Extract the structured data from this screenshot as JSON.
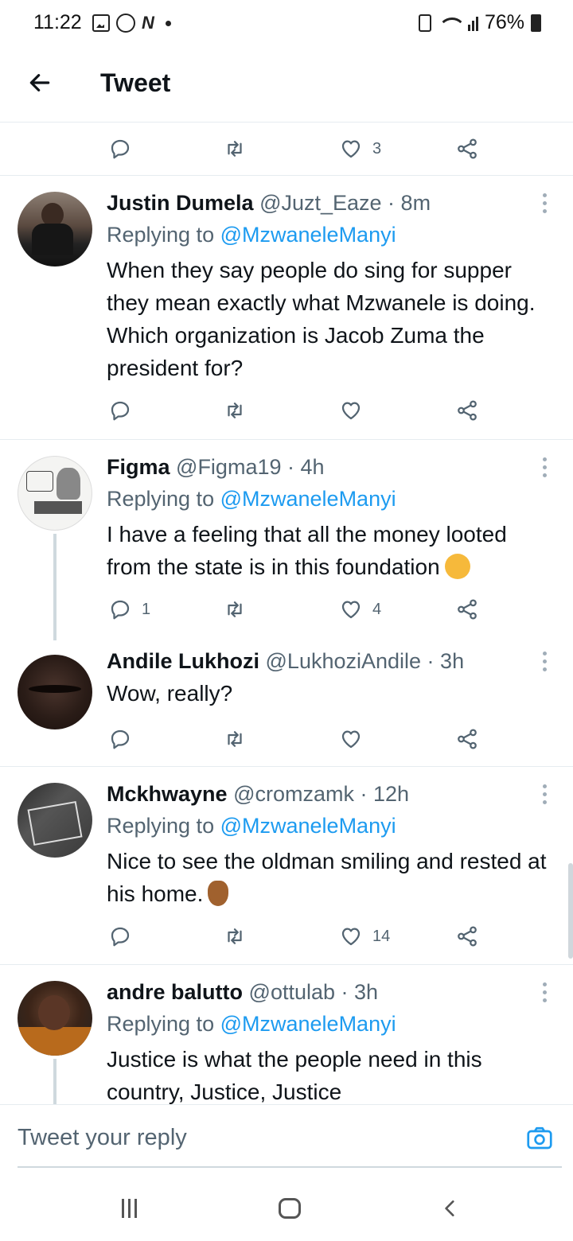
{
  "status_bar": {
    "time": "11:22",
    "battery": "76%"
  },
  "header": {
    "title": "Tweet"
  },
  "top_actions": {
    "likes": "3"
  },
  "tweets": [
    {
      "name": "Justin Dumela",
      "handle": "@Juzt_Eaze",
      "time": "8m",
      "replying_prefix": "Replying to",
      "replying_to": "@MzwaneleManyi",
      "text": "When they say people do sing for supper they mean exactly what Mzwanele is doing. Which organization is Jacob Zuma the president for?",
      "replies": "",
      "likes": ""
    },
    {
      "name": "Figma",
      "handle": "@Figma19",
      "time": "4h",
      "replying_prefix": "Replying to",
      "replying_to": "@MzwaneleManyi",
      "text": "I have a feeling that all the money looted from the state is in this foundation",
      "emoji": "thinking-face",
      "replies": "1",
      "likes": "4"
    },
    {
      "name": "Andile Lukhozi",
      "handle": "@LukhoziAndile",
      "time": "3h",
      "text": "Wow, really?",
      "replies": "",
      "likes": ""
    },
    {
      "name": "Mckhwayne",
      "handle": "@cromzamk",
      "time": "12h",
      "replying_prefix": "Replying to",
      "replying_to": "@MzwaneleManyi",
      "text": "Nice to see the oldman smiling and rested at his home.",
      "emoji": "ok-hand",
      "replies": "",
      "likes": "14"
    },
    {
      "name": "andre balutto",
      "handle": "@ottulab",
      "time": "3h",
      "replying_prefix": "Replying to",
      "replying_to": "@MzwaneleManyi",
      "text": "Justice is what the people need in this country, Justice, Justice"
    }
  ],
  "reply_bar": {
    "placeholder": "Tweet your reply"
  },
  "colors": {
    "accent": "#1d9bf0",
    "text_primary": "#0f1419",
    "text_secondary": "#536471",
    "divider": "#e6ecf0"
  }
}
